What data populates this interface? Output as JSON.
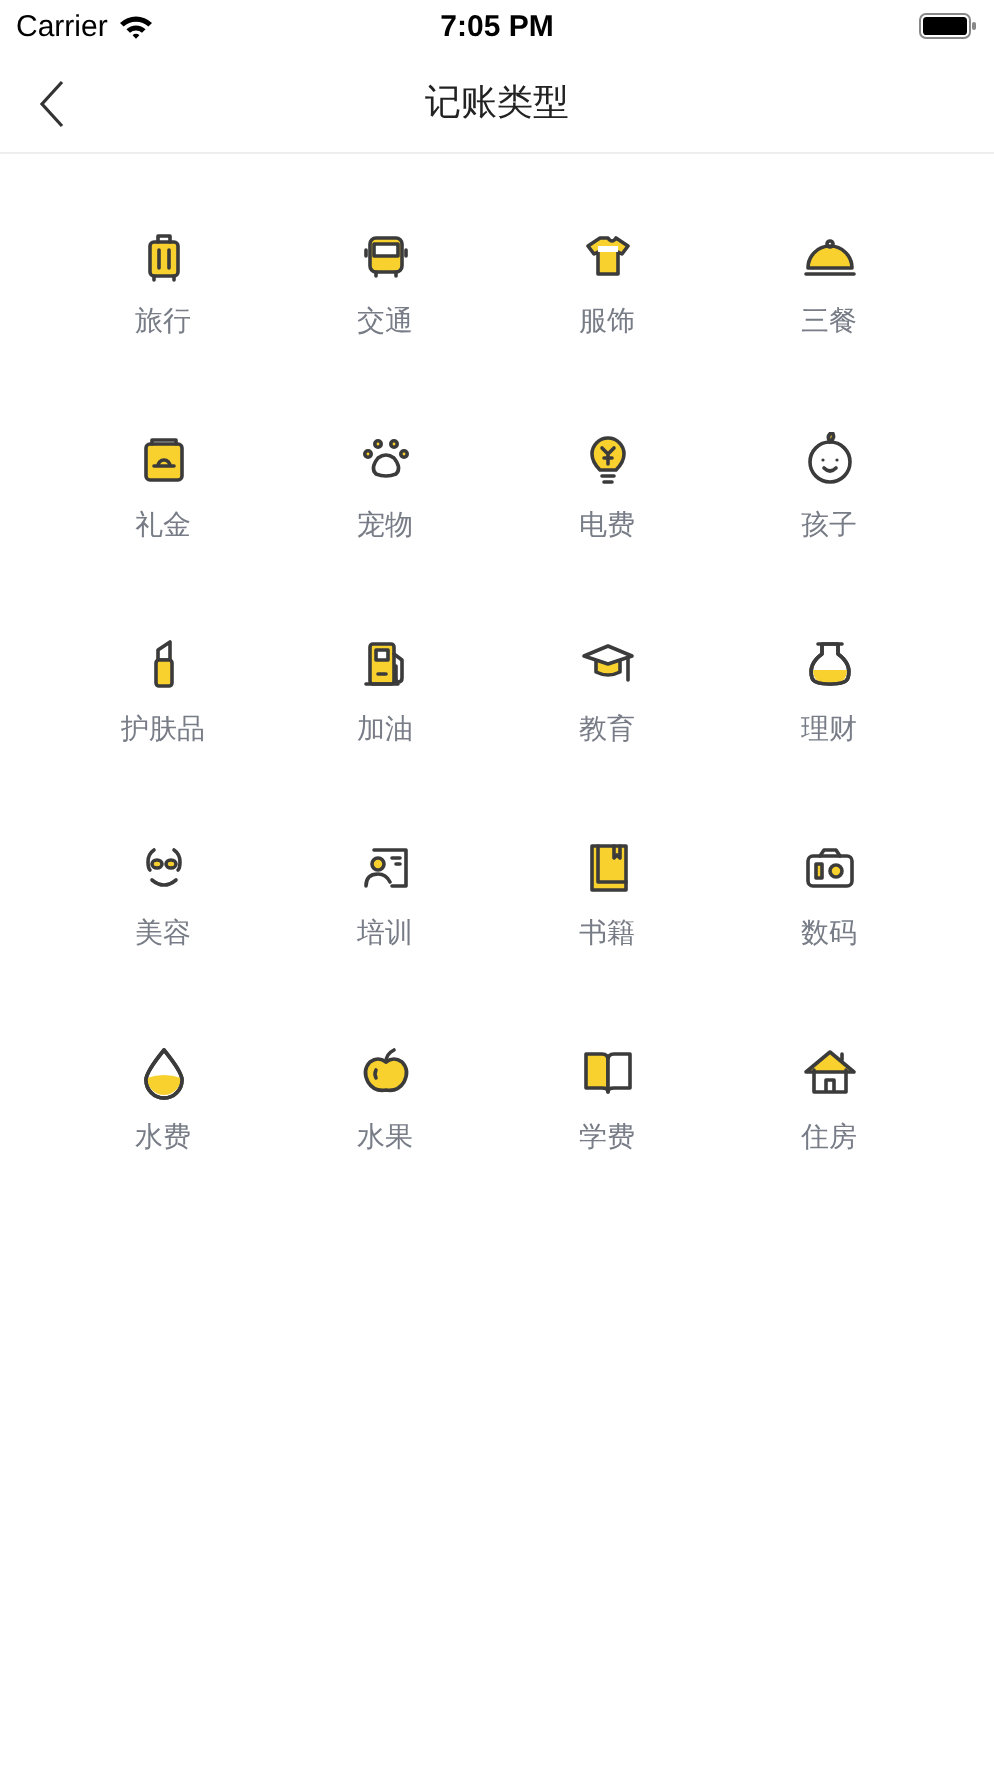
{
  "status_bar": {
    "carrier": "Carrier",
    "time": "7:05 PM"
  },
  "nav": {
    "title": "记账类型"
  },
  "categories": [
    {
      "label": "旅行",
      "kind": "suitcase"
    },
    {
      "label": "交通",
      "kind": "bus"
    },
    {
      "label": "服饰",
      "kind": "shirt"
    },
    {
      "label": "三餐",
      "kind": "cloche"
    },
    {
      "label": "礼金",
      "kind": "gift"
    },
    {
      "label": "宠物",
      "kind": "paw"
    },
    {
      "label": "电费",
      "kind": "bulb"
    },
    {
      "label": "孩子",
      "kind": "baby"
    },
    {
      "label": "护肤品",
      "kind": "lipstick"
    },
    {
      "label": "加油",
      "kind": "fuel"
    },
    {
      "label": "教育",
      "kind": "cap"
    },
    {
      "label": "理财",
      "kind": "flask"
    },
    {
      "label": "美容",
      "kind": "mask"
    },
    {
      "label": "培训",
      "kind": "trainer"
    },
    {
      "label": "书籍",
      "kind": "book"
    },
    {
      "label": "数码",
      "kind": "camera"
    },
    {
      "label": "水费",
      "kind": "drop"
    },
    {
      "label": "水果",
      "kind": "apple"
    },
    {
      "label": "学费",
      "kind": "openbook"
    },
    {
      "label": "住房",
      "kind": "house"
    }
  ]
}
